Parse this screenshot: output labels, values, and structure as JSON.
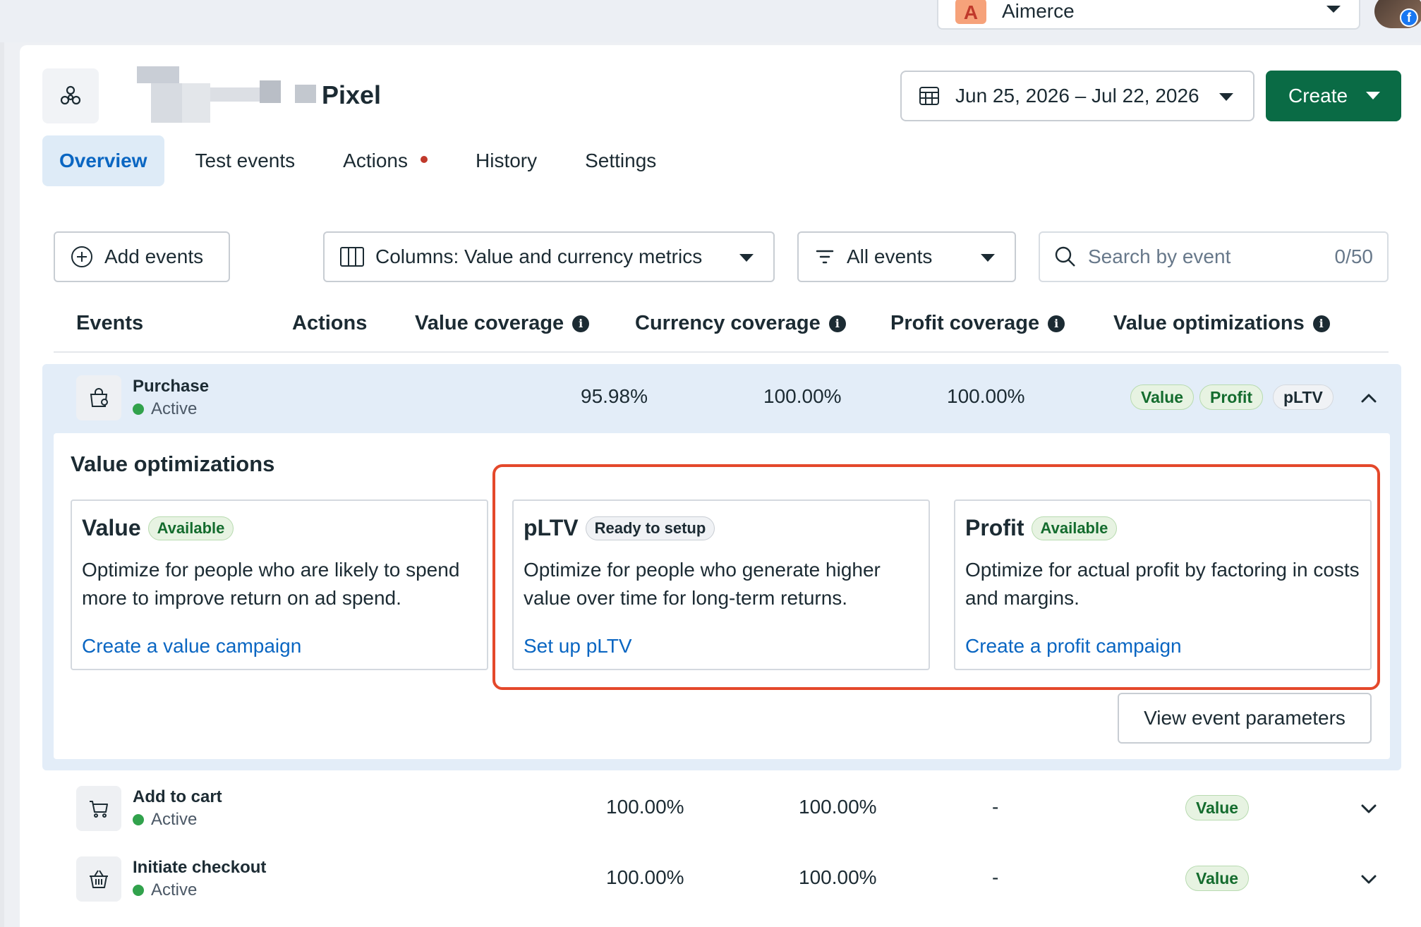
{
  "account": {
    "name": "Aimerce",
    "avatar_letter": "A"
  },
  "header": {
    "title": "Pixel",
    "date_range": "Jun 25, 2026 – Jul 22, 2026",
    "create_label": "Create"
  },
  "tabs": [
    {
      "label": "Overview",
      "active": true
    },
    {
      "label": "Test events"
    },
    {
      "label": "Actions"
    },
    {
      "label": "History"
    },
    {
      "label": "Settings"
    }
  ],
  "toolbar": {
    "add_events": "Add events",
    "columns": "Columns: Value and currency metrics",
    "filter": "All events",
    "search_placeholder": "Search by event",
    "search_count": "0/50"
  },
  "table": {
    "headers": [
      "Events",
      "Actions",
      "Value coverage",
      "Currency coverage",
      "Profit coverage",
      "Value optimizations"
    ],
    "rows": [
      {
        "name": "Purchase",
        "status": "Active",
        "value_coverage": "95.98%",
        "currency_coverage": "100.00%",
        "profit_coverage": "100.00%",
        "optimizations": [
          "Value",
          "Profit",
          "pLTV"
        ],
        "expanded": true
      },
      {
        "name": "Add to cart",
        "status": "Active",
        "value_coverage": "100.00%",
        "currency_coverage": "100.00%",
        "profit_coverage": "-",
        "optimizations": [
          "Value"
        ]
      },
      {
        "name": "Initiate checkout",
        "status": "Active",
        "value_coverage": "100.00%",
        "currency_coverage": "100.00%",
        "profit_coverage": "-",
        "optimizations": [
          "Value"
        ]
      }
    ]
  },
  "value_optimizations": {
    "title": "Value optimizations",
    "cards": [
      {
        "title": "Value",
        "badge": "Available",
        "description": "Optimize for people who are likely to spend more to improve return on ad spend.",
        "link": "Create a value campaign"
      },
      {
        "title": "pLTV",
        "badge": "Ready to setup",
        "description": "Optimize for people who generate higher value over time for long-term returns.",
        "link": "Set up pLTV"
      },
      {
        "title": "Profit",
        "badge": "Available",
        "description": "Optimize for actual profit by factoring in costs and margins.",
        "link": "Create a profit campaign"
      }
    ],
    "view_params": "View event parameters"
  },
  "colors": {
    "accent": "#0a66c2",
    "create_button": "#0a6b45",
    "highlight": "#e4482b",
    "active_dot": "#31a24c"
  },
  "icons": [
    "pixel-icon",
    "calendar-icon",
    "plus-circle-icon",
    "columns-icon",
    "filter-icon",
    "search-icon",
    "info-icon",
    "shopping-bag-icon",
    "cart-icon",
    "basket-icon",
    "chevron-up-icon",
    "chevron-down-icon"
  ]
}
